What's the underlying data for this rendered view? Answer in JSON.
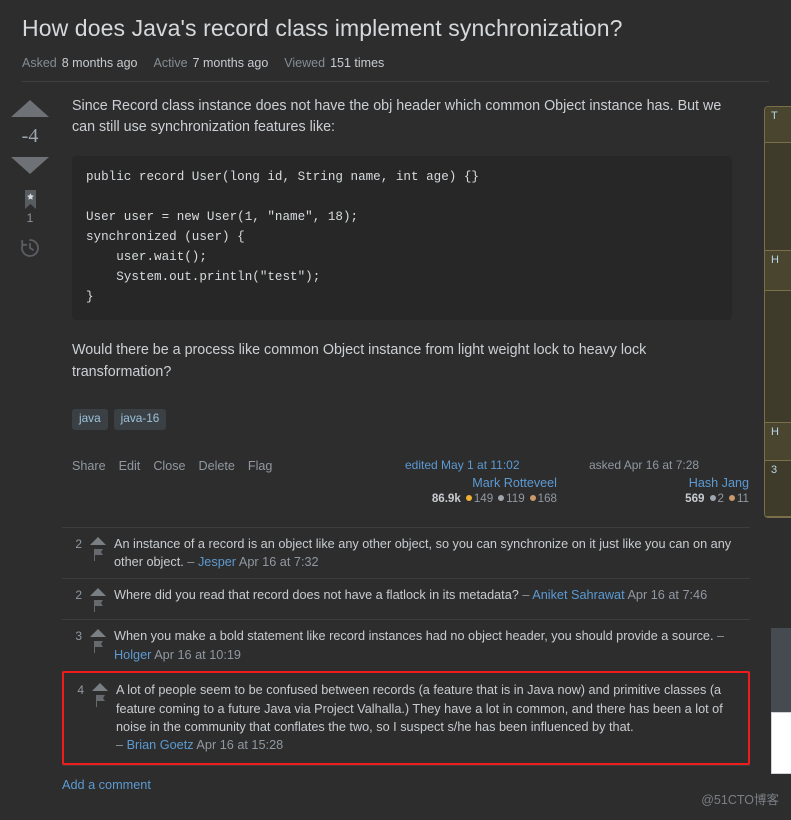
{
  "question": {
    "title": "How does Java's record class implement synchronization?",
    "stats": [
      {
        "label": "Asked",
        "value": "8 months ago"
      },
      {
        "label": "Active",
        "value": "7 months ago"
      },
      {
        "label": "Viewed",
        "value": "151 times"
      }
    ],
    "vote_score": "-4",
    "bookmark_count": "1",
    "paragraph_1": "Since Record class instance does not have the obj header which common Object instance has. But we can still use synchronization features like:",
    "code": "public record User(long id, String name, int age) {}\n\nUser user = new User(1, \"name\", 18);\nsynchronized (user) {\n    user.wait();\n    System.out.println(\"test\");\n}",
    "paragraph_2": "Would there be a process like common Object instance from light weight lock to heavy lock transformation?",
    "tags": [
      "java",
      "java-16"
    ],
    "actions": [
      "Share",
      "Edit",
      "Close",
      "Delete",
      "Flag"
    ],
    "edited_card": {
      "time": "edited May 1 at 11:02",
      "name": "Mark Rotteveel",
      "reputation": "86.9k",
      "gold": "149",
      "silver": "119",
      "bronze": "168"
    },
    "asked_card": {
      "time": "asked Apr 16 at 7:28",
      "name": "Hash Jang",
      "reputation": "569",
      "gold": "",
      "silver": "2",
      "bronze": "11"
    }
  },
  "comments": [
    {
      "score": "2",
      "text": "An instance of a record is an object like any other object, so you can synchronize on it just like you can on any other object.",
      "dash": "–",
      "author": "Jesper",
      "date": "Apr 16 at 7:32",
      "highlighted": false
    },
    {
      "score": "2",
      "text": "Where did you read that record does not have a flatlock in its metadata?",
      "dash": "–",
      "author": "Aniket Sahrawat",
      "date": "Apr 16 at 7:46",
      "highlighted": false
    },
    {
      "score": "3",
      "text": "When you make a bold statement like record instances had no object header, you should provide a source.",
      "dash": "–",
      "author": "Holger",
      "date": "Apr 16 at 10:19",
      "highlighted": false
    },
    {
      "score": "4",
      "text": "A lot of people seem to be confused between records (a feature that is in Java now) and primitive classes (a feature coming to a future Java via Project Valhalla.) They have a lot in common, and there has been a lot of noise in the community that conflates the two, so I suspect s/he has been influenced by that.",
      "dash": "–",
      "author": "Brian Goetz",
      "date": "Apr 16 at 15:28",
      "highlighted": true
    }
  ],
  "add_comment_label": "Add a comment",
  "watermark": "@51CTO博客",
  "colors": {
    "background": "#2d2d2d",
    "code_background": "#272727",
    "link": "#5c9ad2",
    "tag_background": "#3b4045",
    "tag_text": "#9cc3db",
    "highlight_border": "#f01c1c",
    "gold_badge": "#f0b132",
    "silver_badge": "#9fa6ad",
    "bronze_badge": "#cb9a6b"
  }
}
